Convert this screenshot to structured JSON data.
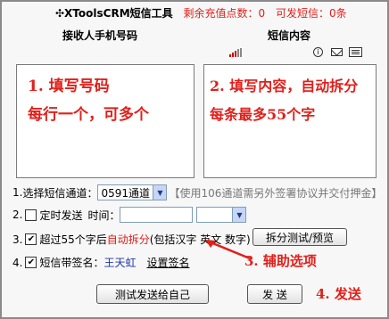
{
  "title": {
    "app": "✣XToolsCRM短信工具",
    "balance": "剩余充值点数：0",
    "sendable": "可发短信：0条"
  },
  "headers": {
    "phone": "接收人手机号码",
    "content": "短信内容"
  },
  "phone_box": {
    "lines": [
      "1. 填写号码",
      "每行一个，可多个"
    ]
  },
  "content_box": {
    "lines": [
      "2. 填写内容，自动拆分",
      "每条最多55个字"
    ]
  },
  "row1": {
    "num": "1.",
    "label": "选择短信通道：",
    "channel": "0591通道",
    "hint": "【使用106通道需另外签署协议并交付押金】"
  },
  "row2": {
    "num": "2.",
    "checked": false,
    "label": "定时发送",
    "time_label": "时间："
  },
  "row3": {
    "num": "3.",
    "checked": true,
    "label_a": "超过55个字后",
    "label_b": "自动拆分",
    "label_c": "(包括汉字 英文 数字)",
    "split_button": "拆分测试/预览"
  },
  "row4": {
    "num": "4.",
    "checked": true,
    "label": "短信带签名：",
    "signature": "王天虹",
    "set_link": "设置签名"
  },
  "buttons": {
    "test_send": "测试发送给自己",
    "send": "发 送"
  },
  "annotations": {
    "step3": "3. 辅助选项",
    "step4": "4. 发送"
  },
  "colors": {
    "accent_red": "#e0201b",
    "signature_blue": "#1c38a6"
  },
  "icons": [
    "signal-icon",
    "info-icon",
    "mail-icon",
    "card-icon"
  ]
}
